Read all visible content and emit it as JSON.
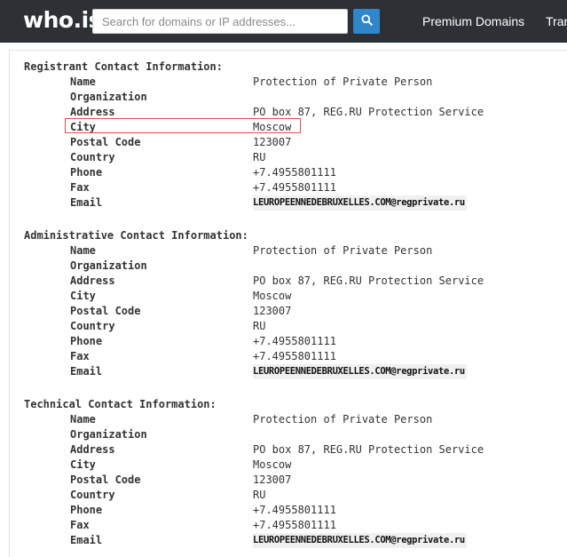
{
  "header": {
    "logo": "who.is",
    "search": {
      "placeholder": "Search for domains or IP addresses...",
      "value": ""
    },
    "nav": [
      "Premium Domains",
      "Tran"
    ]
  },
  "sections": [
    {
      "title": "Registrant Contact Information:",
      "fields": [
        {
          "label": "Name",
          "value": "Protection of Private Person"
        },
        {
          "label": "Organization",
          "value": ""
        },
        {
          "label": "Address",
          "value": "PO box 87, REG.RU Protection Service"
        },
        {
          "label": "City",
          "value": "Moscow",
          "highlighted": true
        },
        {
          "label": "Postal Code",
          "value": "123007"
        },
        {
          "label": "Country",
          "value": "RU"
        },
        {
          "label": "Phone",
          "value": "+7.4955801111"
        },
        {
          "label": "Fax",
          "value": "+7.4955801111"
        },
        {
          "label": "Email",
          "value": "LEUROPEENNEDEBRUXELLES.COM@regprivate.ru"
        }
      ]
    },
    {
      "title": "Administrative Contact Information:",
      "fields": [
        {
          "label": "Name",
          "value": "Protection of Private Person"
        },
        {
          "label": "Organization",
          "value": ""
        },
        {
          "label": "Address",
          "value": "PO box 87, REG.RU Protection Service"
        },
        {
          "label": "City",
          "value": "Moscow"
        },
        {
          "label": "Postal Code",
          "value": "123007"
        },
        {
          "label": "Country",
          "value": "RU"
        },
        {
          "label": "Phone",
          "value": "+7.4955801111"
        },
        {
          "label": "Fax",
          "value": "+7.4955801111"
        },
        {
          "label": "Email",
          "value": "LEUROPEENNEDEBRUXELLES.COM@regprivate.ru"
        }
      ]
    },
    {
      "title": "Technical Contact Information:",
      "fields": [
        {
          "label": "Name",
          "value": "Protection of Private Person"
        },
        {
          "label": "Organization",
          "value": ""
        },
        {
          "label": "Address",
          "value": "PO box 87, REG.RU Protection Service"
        },
        {
          "label": "City",
          "value": "Moscow"
        },
        {
          "label": "Postal Code",
          "value": "123007"
        },
        {
          "label": "Country",
          "value": "RU"
        },
        {
          "label": "Phone",
          "value": "+7.4955801111"
        },
        {
          "label": "Fax",
          "value": "+7.4955801111"
        },
        {
          "label": "Email",
          "value": "LEUROPEENNEDEBRUXELLES.COM@regprivate.ru"
        }
      ]
    }
  ],
  "colors": {
    "header_bg": "#2d3135",
    "search_button": "#2f86c8",
    "highlight_border": "#d9534f",
    "text": "#333333"
  },
  "icons": {
    "search_button": "search-icon"
  }
}
